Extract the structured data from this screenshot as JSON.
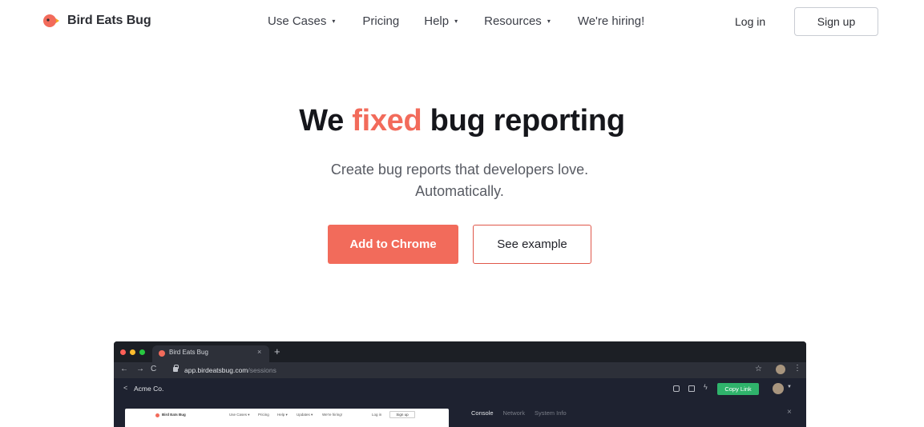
{
  "brand": {
    "name": "Bird Eats Bug",
    "accent_color": "#f26b5b"
  },
  "nav": {
    "items": [
      {
        "label": "Use Cases",
        "has_dropdown": true
      },
      {
        "label": "Pricing",
        "has_dropdown": false
      },
      {
        "label": "Help",
        "has_dropdown": true
      },
      {
        "label": "Resources",
        "has_dropdown": true
      },
      {
        "label": "We're hiring!",
        "has_dropdown": false
      }
    ],
    "dropdown_caret": "▾",
    "login": "Log in",
    "signup": "Sign up"
  },
  "hero": {
    "title_before": "We ",
    "title_accent": "fixed",
    "title_after": " bug reporting",
    "subtitle_line1": "Create bug reports that developers love.",
    "subtitle_line2": "Automatically.",
    "primary_button": "Add to Chrome",
    "secondary_button": "See example"
  },
  "mockup": {
    "tab_title": "Bird Eats Bug",
    "tab_close": "×",
    "new_tab": "+",
    "back": "←",
    "forward": "→",
    "reload": "C",
    "url_host": "app.birdeatsbug.com",
    "url_path": "/sessions",
    "star": "☆",
    "kebab": "⋮",
    "app_back": "<",
    "org_name": "Acme Co.",
    "bolt": "ϟ",
    "copy_link": "Copy Link",
    "caret": "▼",
    "preview": {
      "brand": "Bird Eats Bug",
      "menu": [
        "Use Cases ▾",
        "Pricing",
        "Help ▾",
        "Updates ▾",
        "We're hiring!"
      ],
      "login": "Log in",
      "signup": "Sign up"
    },
    "devtools_tabs": [
      "Console",
      "Network",
      "System Info"
    ],
    "devtools_close": "×"
  }
}
